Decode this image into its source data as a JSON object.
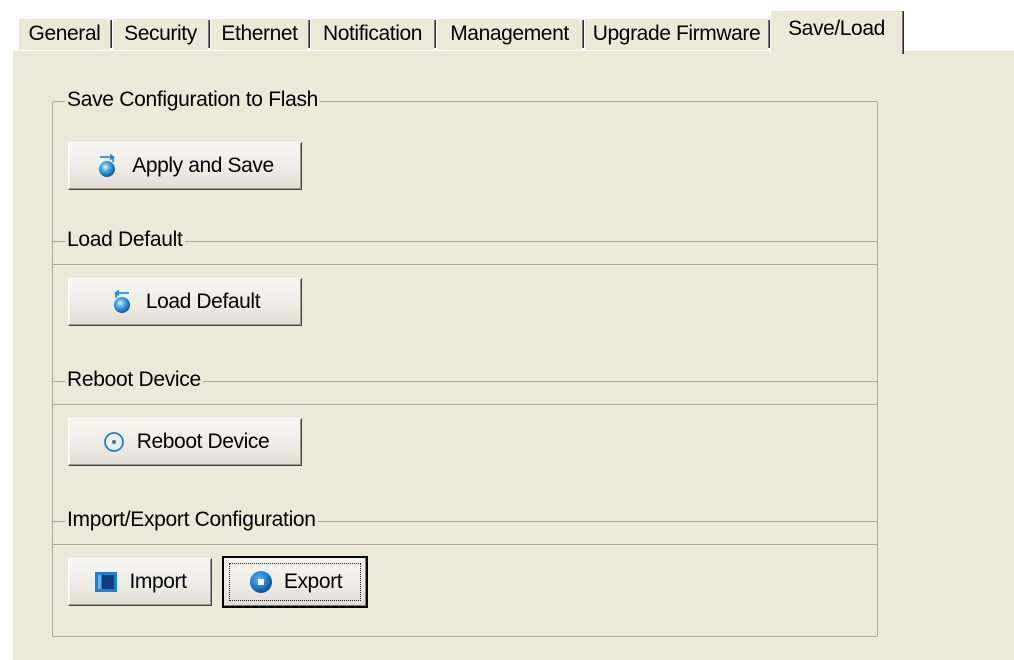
{
  "tabs": [
    {
      "label": "General",
      "active": false
    },
    {
      "label": "Security",
      "active": false
    },
    {
      "label": "Ethernet",
      "active": false
    },
    {
      "label": "Notification",
      "active": false
    },
    {
      "label": "Management",
      "active": false
    },
    {
      "label": "Upgrade Firmware",
      "active": false
    },
    {
      "label": "Save/Load",
      "active": true
    }
  ],
  "groups": {
    "save": {
      "title": "Save Configuration to Flash",
      "button_label": "Apply and Save",
      "icon": "apply-save-icon"
    },
    "load_default": {
      "title": "Load Default",
      "button_label": "Load Default",
      "icon": "load-default-icon"
    },
    "reboot": {
      "title": "Reboot Device",
      "button_label": "Reboot Device",
      "icon": "reboot-icon"
    },
    "import_export": {
      "title": "Import/Export Configuration",
      "import_label": "Import",
      "export_label": "Export",
      "import_icon": "import-icon",
      "export_icon": "export-icon"
    }
  },
  "colors": {
    "panel_background": "#ece9d8",
    "group_border": "#aca899",
    "icon_blue": "#1c7fd1"
  }
}
